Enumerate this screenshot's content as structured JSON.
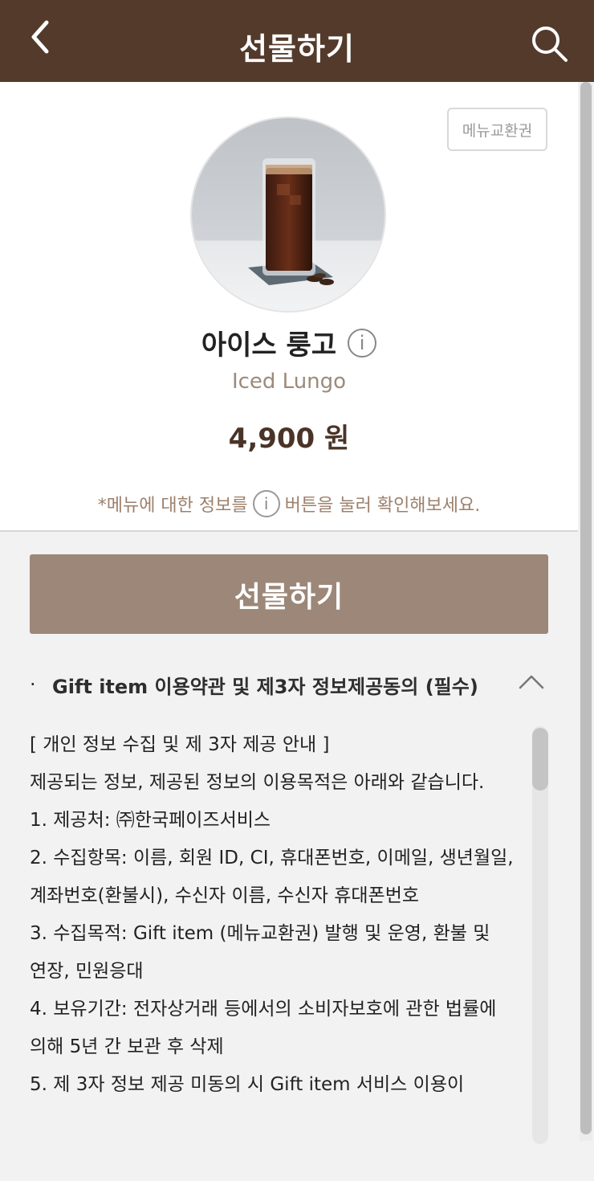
{
  "header": {
    "title": "선물하기"
  },
  "product": {
    "badge": "메뉴교환권",
    "name_ko": "아이스 룽고",
    "name_en": "Iced Lungo",
    "price": "4,900 원",
    "info_icon_glyph": "i"
  },
  "notice": {
    "before": "*메뉴에 대한 정보를",
    "after": "버튼을 눌러 확인해보세요."
  },
  "gift_button": {
    "label": "선물하기"
  },
  "terms": {
    "bullet": "·",
    "title": "Gift item 이용약관 및 제3자 정보제공동의 (필수)",
    "lines": [
      "[ 개인 정보 수집 및 제 3자 제공 안내 ]",
      "제공되는 정보, 제공된 정보의 이용목적은 아래와 같습니다.",
      "1. 제공처: ㈜한국페이즈서비스",
      "2. 수집항목: 이름, 회원 ID, CI, 휴대폰번호, 이메일, 생년월일, 계좌번호(환불시), 수신자 이름, 수신자 휴대폰번호",
      "3. 수집목적: Gift item (메뉴교환권) 발행 및 운영, 환불 및 연장, 민원응대",
      "4. 보유기간: 전자상거래 등에서의 소비자보호에 관한 법률에 의해 5년 간 보관 후 삭제",
      "5. 제 3자 정보 제공 미동의 시 Gift item 서비스 이용이"
    ]
  },
  "colors": {
    "header_bg": "#533a2b",
    "button_bg": "#9c8779",
    "price": "#4a3427",
    "english_name": "#9c8a7a"
  },
  "icons": {
    "back": "chevron-left-icon",
    "search": "search-icon",
    "collapse": "chevron-up-icon",
    "info": "info-icon"
  }
}
